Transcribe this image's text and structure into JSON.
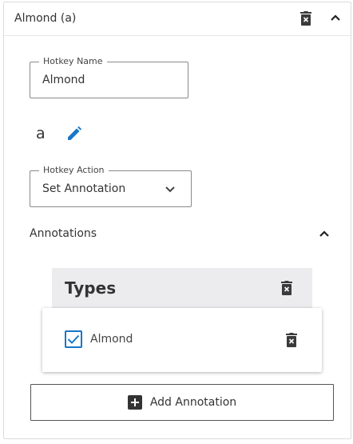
{
  "hotkey": {
    "title": "Almond (a)",
    "name_field": {
      "label": "Hotkey Name",
      "value": "Almond"
    },
    "key": "a",
    "action_field": {
      "label": "Hotkey Action",
      "value": "Set Annotation"
    }
  },
  "annotations": {
    "section_label": "Annotations",
    "group": {
      "title": "Types",
      "items": [
        {
          "label": "Almond",
          "checked": true
        }
      ]
    },
    "add_button_label": "Add Annotation"
  },
  "colors": {
    "accent": "#1976c8",
    "group_header_bg": "#ececee",
    "icon": "#3a3a3a"
  },
  "icons": {
    "delete": "trash-icon",
    "collapse": "chevron-up-icon",
    "edit": "pencil-icon",
    "dropdown": "chevron-down-icon",
    "add": "plus-box-icon"
  }
}
